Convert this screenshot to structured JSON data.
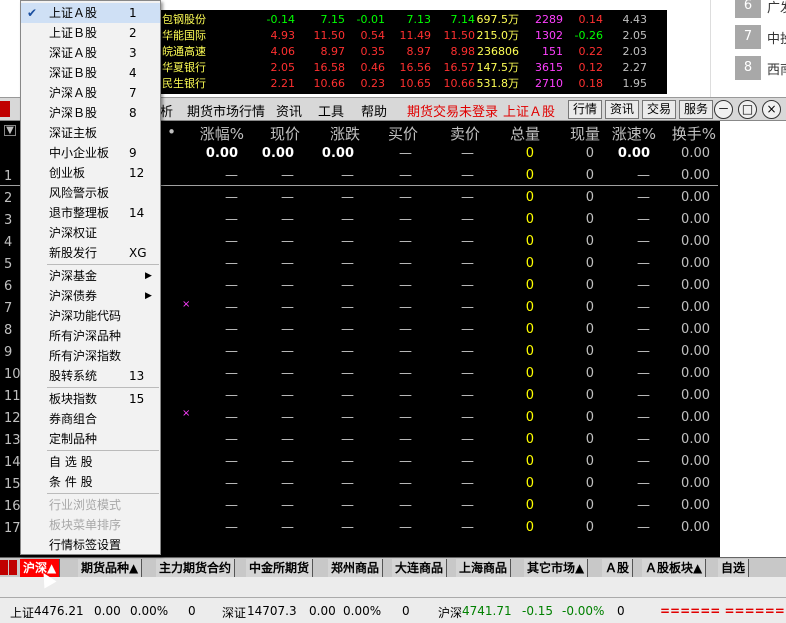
{
  "mini_quotes": [
    {
      "name": "包钢股份",
      "v1": "-0.14",
      "v2": "7.15",
      "v3": "-0.01",
      "v4": "7.13",
      "v5": "7.14",
      "v6": "697.5万",
      "v7": "2289",
      "v8": "0.14",
      "v9": "4.43"
    },
    {
      "name": "华能国际",
      "v1": "4.93",
      "v2": "11.50",
      "v3": "0.54",
      "v4": "11.49",
      "v5": "11.50",
      "v6": "215.0万",
      "v7": "1302",
      "v8": "-0.26",
      "v9": "2.05"
    },
    {
      "name": "皖通高速",
      "v1": "4.06",
      "v2": "8.97",
      "v3": "0.35",
      "v4": "8.97",
      "v5": "8.98",
      "v6": "236806",
      "v7": "151",
      "v8": "0.22",
      "v9": "2.03"
    },
    {
      "name": "华夏银行",
      "v1": "2.05",
      "v2": "16.58",
      "v3": "0.46",
      "v4": "16.56",
      "v5": "16.57",
      "v6": "147.5万",
      "v7": "3615",
      "v8": "0.12",
      "v9": "2.27"
    },
    {
      "name": "民生银行",
      "v1": "2.21",
      "v2": "10.66",
      "v3": "0.23",
      "v4": "10.65",
      "v5": "10.66",
      "v6": "531.8万",
      "v7": "2710",
      "v8": "0.18",
      "v9": "1.95"
    }
  ],
  "right_panel": [
    {
      "num": "6",
      "label": "广发"
    },
    {
      "num": "7",
      "label": "中投"
    },
    {
      "num": "8",
      "label": "西南"
    }
  ],
  "menubar": {
    "item_partial": "析",
    "futures_market": "期货市场行情",
    "info": "资讯",
    "tools": "工具",
    "help": "帮助",
    "futures_login": "期货交易未登录",
    "current_board": "上证Ａ股",
    "btn_quote": "行情",
    "btn_info": "资讯",
    "btn_trade": "交易",
    "btn_service": "服务",
    "win_min": "－",
    "win_max": "□",
    "win_close": "×"
  },
  "grid": {
    "headers": [
      "•",
      "涨幅%",
      "现价",
      "涨跌",
      "买价",
      "卖价",
      "总量",
      "现量",
      "涨速%",
      "换手%"
    ],
    "summary_row": [
      "0.00",
      "0.00",
      "0.00",
      "—",
      "—",
      "0",
      "0",
      "0.00",
      "0.00"
    ],
    "row_numbers": [
      "1",
      "2",
      "3",
      "4",
      "5",
      "6",
      "7",
      "8",
      "9",
      "10",
      "11",
      "12",
      "13",
      "14",
      "15",
      "16",
      "17"
    ],
    "row_cells": [
      "—",
      "—",
      "—",
      "—",
      "—",
      "0",
      "0",
      "—",
      "0.00"
    ]
  },
  "tabs": [
    "沪深▲",
    "期货品种▲",
    "主力期货合约",
    "中金所期货",
    "郑州商品",
    "大连商品",
    "上海商品",
    "其它市场▲",
    "Ａ股",
    "Ａ股板块▲",
    "自选"
  ],
  "statusbar": {
    "sh_label": "上证",
    "sh_value": "4476.21",
    "sh_change": "0.00",
    "sh_pct": "0.00%",
    "sh_vol": "0",
    "sz_label": "深证",
    "sz_value": "14707.3",
    "sz_change": "0.00",
    "sz_pct": "0.00%",
    "sz_vol": "0",
    "hs_label": "沪深",
    "hs_value": "4741.71",
    "hs_change": "-0.15",
    "hs_pct": "-0.00%",
    "hs_vol": "0",
    "indicator": "====== ======"
  },
  "dropdown": [
    {
      "label": "上证Ａ股",
      "key": "1",
      "checked": true
    },
    {
      "label": "上证Ｂ股",
      "key": "2"
    },
    {
      "label": "深证Ａ股",
      "key": "3"
    },
    {
      "label": "深证Ｂ股",
      "key": "4"
    },
    {
      "label": "沪深Ａ股",
      "key": "7"
    },
    {
      "label": "沪深Ｂ股",
      "key": "8"
    },
    {
      "label": "深证主板",
      "key": ""
    },
    {
      "label": "中小企业板",
      "key": "9"
    },
    {
      "label": "创业板",
      "key": "12"
    },
    {
      "label": "风险警示板",
      "key": ""
    },
    {
      "label": "退市整理板",
      "key": "14"
    },
    {
      "label": "沪深权证",
      "key": ""
    },
    {
      "label": "新股发行",
      "key": "XG"
    },
    {
      "label": "沪深基金",
      "key": "",
      "submenu": true
    },
    {
      "label": "沪深债券",
      "key": "",
      "submenu": true
    },
    {
      "label": "沪深功能代码",
      "key": ""
    },
    {
      "label": "所有沪深品种",
      "key": ""
    },
    {
      "label": "所有沪深指数",
      "key": ""
    },
    {
      "label": "股转系统",
      "key": "13"
    },
    {
      "label": "板块指数",
      "key": "15"
    },
    {
      "label": "券商组合",
      "key": ""
    },
    {
      "label": "定制品种",
      "key": ""
    },
    {
      "label": "自 选 股",
      "key": ""
    },
    {
      "label": "条 件 股",
      "key": ""
    },
    {
      "label": "行业浏览模式",
      "key": "",
      "disabled": true
    },
    {
      "label": "板块菜单排序",
      "key": "",
      "disabled": true
    },
    {
      "label": "行情标签设置",
      "key": ""
    }
  ],
  "colors": {
    "up": "#ff3030",
    "down": "#00ff00",
    "volume": "#ffff00",
    "active_tab": "#ff0000"
  }
}
